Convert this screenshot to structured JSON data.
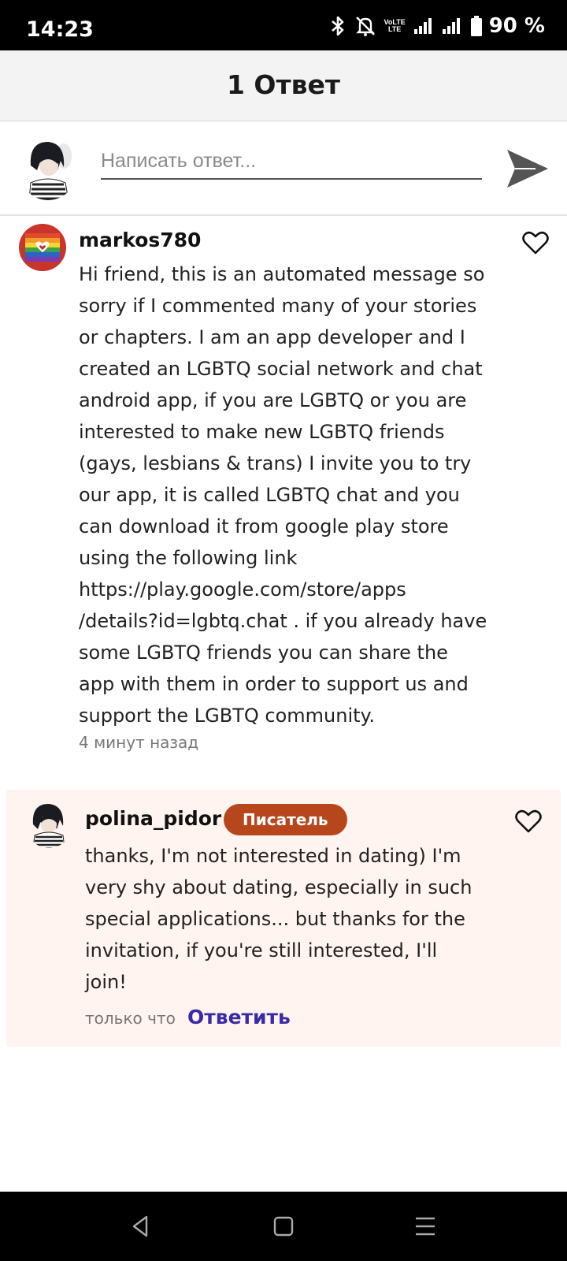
{
  "status_bar": {
    "time": "14:23",
    "battery": "90 %",
    "volte_top": "VoLTE",
    "lte_label": "LTE",
    "icons": [
      "bluetooth-icon",
      "notifications-off-icon",
      "volte-icon",
      "signal-icon",
      "signal-icon",
      "battery-icon"
    ]
  },
  "header": {
    "title": "1 Ответ"
  },
  "composer": {
    "placeholder": "Написать ответ...",
    "send_icon": "send-icon"
  },
  "comments": [
    {
      "username": "markos780",
      "body": "Hi friend, this is an automated message so\nsorry if I commented many of your stories\nor chapters. I am an app developer and I\ncreated an LGBTQ social network and chat\nandroid app, if you are LGBTQ or you are\ninterested to make new LGBTQ friends\n(gays, lesbians & trans) I invite you to try\nour app, it is called LGBTQ chat and you\ncan download it from google play store\nusing the following link\nhttps://play.google.com/store/apps\n/details?id=lgbtq.chat . if you already have\nsome LGBTQ friends you can share the\napp with them in order to support us and\nsupport the LGBTQ community.",
      "time": "4 минут назад",
      "like_icon": "heart-icon"
    },
    {
      "username": "polina_pidor",
      "badge": "Писатель",
      "body": "thanks, I'm not interested in dating) I'm\nvery shy about dating, especially in such\nspecial applications... but thanks for the\ninvitation, if you're still interested, I'll\njoin!",
      "time": "только что",
      "reply_label": "Ответить",
      "like_icon": "heart-icon"
    }
  ],
  "nav_bar": {
    "icons": [
      "back-icon",
      "home-icon",
      "recents-icon"
    ]
  },
  "colors": {
    "badge": "#b8461c",
    "reply_link": "#3a2aa6",
    "reply_bg": "#fff4ef",
    "header_bg": "#f3f3f3"
  }
}
